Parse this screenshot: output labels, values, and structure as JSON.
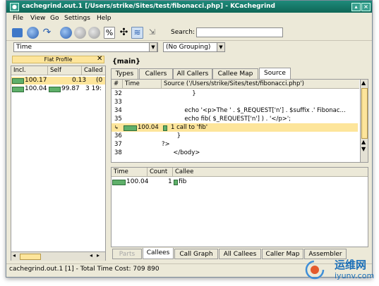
{
  "window": {
    "title": "cachegrind.out.1 [/Users/strike/Sites/test/fibonacci.php] - KCachegrind"
  },
  "menu": [
    "File",
    "View",
    "Go",
    "Settings",
    "Help"
  ],
  "toolbar": {
    "search_label": "Search:",
    "search_value": ""
  },
  "selectors": {
    "event_type": "Time",
    "grouping": "(No Grouping)"
  },
  "flat_profile": {
    "title": "Flat Profile",
    "columns": [
      "Incl.",
      "Self",
      "Called"
    ],
    "rows": [
      {
        "incl": "100.17",
        "self": "0.13",
        "called": "(0",
        "incl_pct": 100,
        "self_pct": 0.13,
        "selected": true
      },
      {
        "incl": "100.04",
        "self": "99.87",
        "called": "3 19:",
        "incl_pct": 100,
        "self_pct": 99.87,
        "selected": false
      }
    ]
  },
  "function_label": "{main}",
  "top_tabs": [
    "Types",
    "Callers",
    "All Callers",
    "Callee Map",
    "Source"
  ],
  "source": {
    "columns": [
      "#",
      "Time",
      "Source ('/Users/strike/Sites/test/fibonacci.php')"
    ],
    "lines": [
      {
        "ln": "32",
        "code": "                }"
      },
      {
        "ln": "33",
        "code": ""
      },
      {
        "ln": "34",
        "code": "            echo '<p>The ' . $_REQUEST['n'] . $suffix .' Fibonac..."
      },
      {
        "ln": "35",
        "code": "            echo fib( $_REQUEST['n'] ) . '</p>';"
      },
      {
        "ln": "",
        "time": "100.04",
        "code": "1 call to 'fib'",
        "highlight": true
      },
      {
        "ln": "36",
        "code": "        }"
      },
      {
        "ln": "37",
        "code": "?>"
      },
      {
        "ln": "38",
        "code": "      </body>"
      }
    ]
  },
  "callees": {
    "columns": [
      "Time",
      "Count",
      "Callee"
    ],
    "rows": [
      {
        "time": "100.04",
        "count": "1",
        "callee": "fib"
      }
    ]
  },
  "bottom_tabs": [
    "Parts",
    "Callees",
    "Call Graph",
    "All Callees",
    "Caller Map",
    "Assembler"
  ],
  "status": "cachegrind.out.1 [1] - Total Time Cost:  709 890",
  "watermark": {
    "cn": "运维网",
    "latin": "iyunv.com"
  },
  "colors": {
    "title_teal": "#0f6757",
    "highlight": "#fde59b",
    "bar_green": "#5fb06a"
  }
}
